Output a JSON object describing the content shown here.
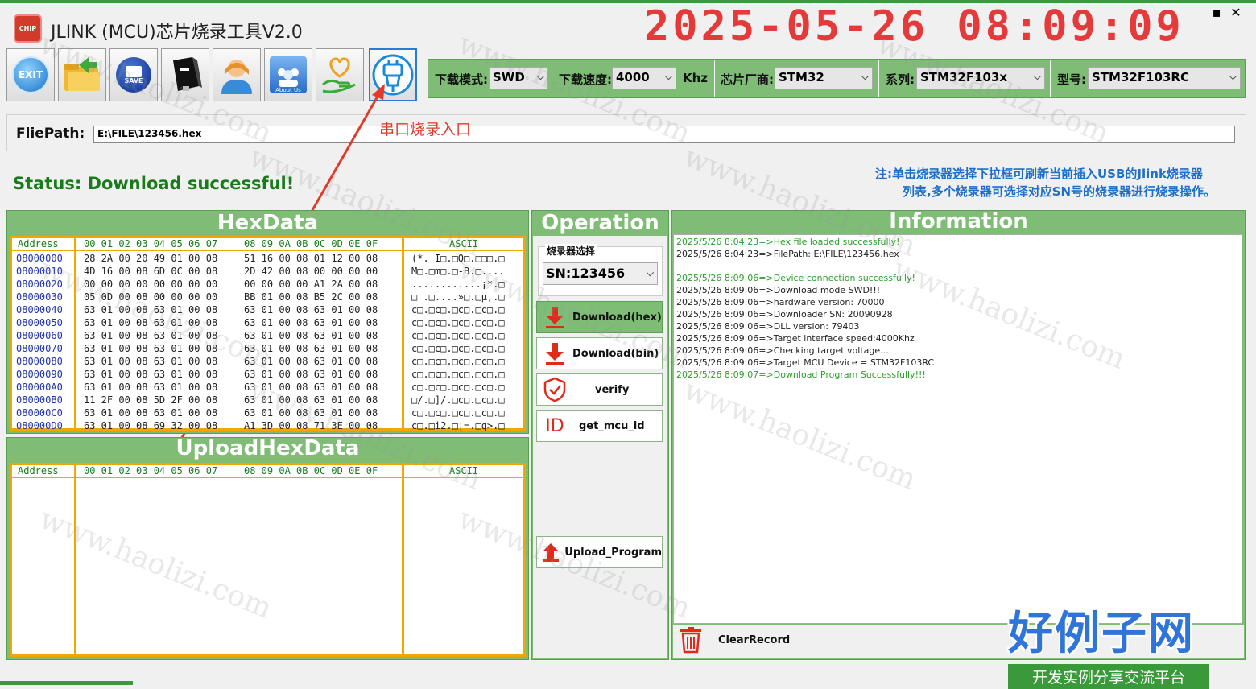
{
  "window": {
    "title": "JLINK (MCU)芯片烧录工具V2.0",
    "clock": "2025-05-26 08:09:09",
    "minimize": "▪",
    "close": "✕"
  },
  "toolbar": {
    "exit_label": "EXIT",
    "save_label": "SAVE",
    "about_label": "About Us"
  },
  "options": {
    "mode_label": "下载模式:",
    "mode_value": "SWD",
    "speed_label": "下载速度:",
    "speed_value": "4000",
    "speed_unit": "Khz",
    "vendor_label": "芯片厂商:",
    "vendor_value": "STM32",
    "series_label": "系列:",
    "series_value": "STM32F103x",
    "model_label": "型号:",
    "model_value": "STM32F103RC"
  },
  "filepath": {
    "label": "FliePath:",
    "value": "E:\\FILE\\123456.hex"
  },
  "annotation": "串口烧录入口",
  "status": "Status: Download successful!",
  "note": {
    "line1": "注:单击烧录器选择下拉框可刷新当前插入USB的Jlink烧录器",
    "line2": "列表,多个烧录器可选择对应SN号的烧录器进行烧录操作。"
  },
  "hexdata": {
    "title": "HexData",
    "header_address": "Address",
    "header_bytes_1": "00 01 02 03 04 05 06 07",
    "header_bytes_2": "08 09 0A 0B 0C 0D 0E 0F",
    "header_ascii": "ASCII",
    "rows": [
      {
        "addr": "08000000",
        "b1": "28 2A 00 20 49 01 00 08",
        "b2": "51 16 00 08 01 12 00 08",
        "ascii": "(*. I□.□Q□.□□□.□"
      },
      {
        "addr": "08000010",
        "b1": "4D 16 00 08 6D 0C 00 08",
        "b2": "2D 42 00 08 00 00 00 00",
        "ascii": "M□.□m□.□-B.□...."
      },
      {
        "addr": "08000020",
        "b1": "00 00 00 00 00 00 00 00",
        "b2": "00 00 00 00 A1 2A 00 08",
        "ascii": "............¡*.□"
      },
      {
        "addr": "08000030",
        "b1": "05 0D 00 08 00 00 00 00",
        "b2": "BB 01 00 08 B5 2C 00 08",
        "ascii": "□ .□....»□.□µ,.□"
      },
      {
        "addr": "08000040",
        "b1": "63 01 00 08 63 01 00 08",
        "b2": "63 01 00 08 63 01 00 08",
        "ascii": "c□.□c□.□c□.□c□.□"
      },
      {
        "addr": "08000050",
        "b1": "63 01 00 08 63 01 00 08",
        "b2": "63 01 00 08 63 01 00 08",
        "ascii": "c□.□c□.□c□.□c□.□"
      },
      {
        "addr": "08000060",
        "b1": "63 01 00 08 63 01 00 08",
        "b2": "63 01 00 08 63 01 00 08",
        "ascii": "c□.□c□.□c□.□c□.□"
      },
      {
        "addr": "08000070",
        "b1": "63 01 00 08 63 01 00 08",
        "b2": "63 01 00 08 63 01 00 08",
        "ascii": "c□.□c□.□c□.□c□.□"
      },
      {
        "addr": "08000080",
        "b1": "63 01 00 08 63 01 00 08",
        "b2": "63 01 00 08 63 01 00 08",
        "ascii": "c□.□c□.□c□.□c□.□"
      },
      {
        "addr": "08000090",
        "b1": "63 01 00 08 63 01 00 08",
        "b2": "63 01 00 08 63 01 00 08",
        "ascii": "c□.□c□.□c□.□c□.□"
      },
      {
        "addr": "080000A0",
        "b1": "63 01 00 08 63 01 00 08",
        "b2": "63 01 00 08 63 01 00 08",
        "ascii": "c□.□c□.□c□.□c□.□"
      },
      {
        "addr": "080000B0",
        "b1": "11 2F 00 08 5D 2F 00 08",
        "b2": "63 01 00 08 63 01 00 08",
        "ascii": "□/.□]/.□c□.□c□.□"
      },
      {
        "addr": "080000C0",
        "b1": "63 01 00 08 63 01 00 08",
        "b2": "63 01 00 08 63 01 00 08",
        "ascii": "c□.□c□.□c□.□c□.□"
      },
      {
        "addr": "080000D0",
        "b1": "63 01 00 08 69 32 00 08",
        "b2": "A1 3D 00 08 71 3E 00 08",
        "ascii": "c□.□i2.□¡=.□q>.□"
      }
    ]
  },
  "uploadhex": {
    "title": "UploadHexData",
    "header_address": "Address",
    "header_bytes_1": "00 01 02 03 04 05 06 07",
    "header_bytes_2": "08 09 0A 0B 0C 0D 0E 0F",
    "header_ascii": "ASCII"
  },
  "operation": {
    "title": "Operation",
    "programmer_label": "烧录器选择",
    "programmer_value": "SN:123456",
    "download_hex": "Download(hex)",
    "download_bin": "Download(bin)",
    "verify": "verify",
    "id_icon_text": "ID",
    "get_mcu_id": "get_mcu_id",
    "upload_program": "Upload_Program"
  },
  "information": {
    "title": "Information",
    "logs": [
      {
        "text": "2025/5/26 8:04:23=>Hex file loaded successfully!",
        "color": "green"
      },
      {
        "text": "2025/5/26 8:04:23=>FilePath:  E:\\FILE\\123456.hex",
        "color": "black"
      },
      {
        "text": "",
        "color": "black"
      },
      {
        "text": "2025/5/26 8:09:06=>Device connection successfully!",
        "color": "green"
      },
      {
        "text": "2025/5/26 8:09:06=>Download mode SWD!!!",
        "color": "black"
      },
      {
        "text": "2025/5/26 8:09:06=>hardware version: 70000",
        "color": "black"
      },
      {
        "text": "2025/5/26 8:09:06=>Downloader SN: 20090928",
        "color": "black"
      },
      {
        "text": "2025/5/26 8:09:06=>DLL version: 79403",
        "color": "black"
      },
      {
        "text": "2025/5/26 8:09:06=>Target interface speed:4000Khz",
        "color": "black"
      },
      {
        "text": "2025/5/26 8:09:06=>Checking target voltage...",
        "color": "black"
      },
      {
        "text": "2025/5/26 8:09:06=>Target MCU Device = STM32F103RC",
        "color": "black"
      },
      {
        "text": "2025/5/26 8:09:07=>Download Program Successfully!!!",
        "color": "green"
      }
    ],
    "clear_record": "ClearRecord"
  },
  "watermark": {
    "text": "www.haolizi.com",
    "brand_big": "好例子网",
    "brand_small": "开发实例分享交流平台"
  },
  "colors": {
    "panel_green": "#7fbd76",
    "hex_border": "#f0a800",
    "status_green": "#1b7a1b",
    "note_blue": "#1d6fc9",
    "clock_red": "#e53a3a"
  }
}
